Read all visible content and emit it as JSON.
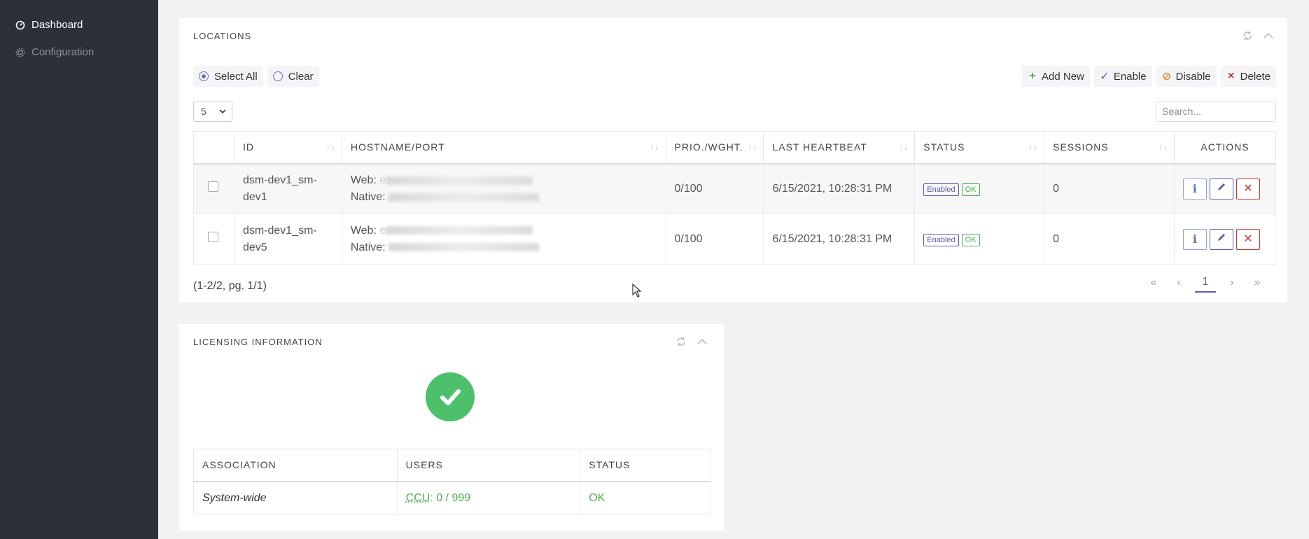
{
  "sidebar": {
    "items": [
      {
        "label": "Dashboard",
        "icon": "gauge-icon",
        "active": true
      },
      {
        "label": "Configuration",
        "icon": "gear-icon",
        "active": false
      }
    ]
  },
  "locations": {
    "title": "LOCATIONS",
    "select_all": "Select All",
    "clear": "Clear",
    "actions": {
      "add_new": "Add New",
      "enable": "Enable",
      "disable": "Disable",
      "delete": "Delete"
    },
    "page_size": "5",
    "search_placeholder": "Search...",
    "columns": [
      "ID",
      "HOSTNAME/PORT",
      "PRIO./WGHT.",
      "LAST HEARTBEAT",
      "STATUS",
      "SESSIONS",
      "ACTIONS"
    ],
    "rows": [
      {
        "id_line1": "dsm-dev1_sm-",
        "id_line2": "dev1",
        "web_label": "Web:",
        "web_value_first_char": "e",
        "native_label": "Native:",
        "prio": "0/100",
        "heartbeat": "6/15/2021, 10:28:31 PM",
        "status_badge": "Enabled",
        "health_badge": "OK",
        "sessions": "0"
      },
      {
        "id_line1": "dsm-dev1_sm-",
        "id_line2": "dev5",
        "web_label": "Web:",
        "web_value_first_char": "e",
        "native_label": "Native:",
        "prio": "0/100",
        "heartbeat": "6/15/2021, 10:28:31 PM",
        "status_badge": "Enabled",
        "health_badge": "OK",
        "sessions": "0"
      }
    ],
    "record_info": "(1-2/2, pg. 1/1)",
    "pager": {
      "current": "1"
    }
  },
  "licensing": {
    "title": "LICENSING INFORMATION",
    "columns": [
      "ASSOCIATION",
      "USERS",
      "STATUS"
    ],
    "rows": [
      {
        "association": "System-wide",
        "users_label": "CCU",
        "users_value": ": 0 / 999",
        "status": "OK"
      }
    ]
  },
  "colors": {
    "sidebar_bg": "#2b303b",
    "accent": "#5a5fb0",
    "success": "#4caf50",
    "danger": "#c0392b",
    "warning": "#e08a3c"
  }
}
